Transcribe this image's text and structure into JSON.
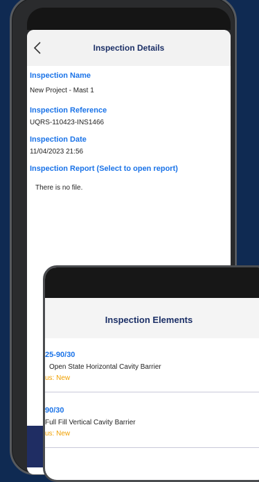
{
  "details_screen": {
    "header": {
      "title": "Inspection Details",
      "back_icon": "chevron-left-icon"
    },
    "fields": [
      {
        "label": "Inspection Name",
        "value": "New Project - Mast 1"
      },
      {
        "label": "Inspection Reference",
        "value": "UQRS-110423-INS1466"
      },
      {
        "label": "Inspection Date",
        "value": "11/04/2023 21:56"
      },
      {
        "label": "Inspection Report (Select to open report)",
        "value": "There is no file."
      }
    ]
  },
  "elements_screen": {
    "header": {
      "title": "Inspection Elements"
    },
    "items": [
      {
        "code": "25-90/30",
        "name": "Open State Horizontal Cavity Barrier",
        "status": "us: New"
      },
      {
        "code": "90/30",
        "name": "Full Fill Vertical Cavity Barrier",
        "status": "us: New"
      }
    ]
  },
  "colors": {
    "background": "#0f2a52",
    "label_blue": "#1a73e8",
    "title_navy": "#1b2f66",
    "status_orange": "#f0a000"
  }
}
